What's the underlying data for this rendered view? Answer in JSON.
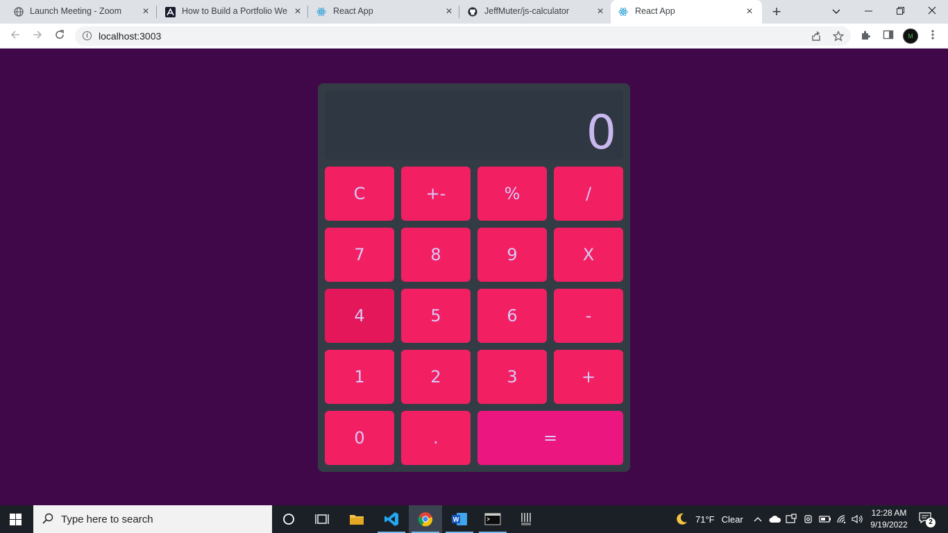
{
  "browser": {
    "tabs": [
      {
        "title": "Launch Meeting - Zoom",
        "icon": "globe-icon",
        "active": false
      },
      {
        "title": "How to Build a Portfolio Web",
        "icon": "site-logo-icon",
        "active": false
      },
      {
        "title": "React App",
        "icon": "react-icon",
        "active": false
      },
      {
        "title": "JeffMuter/js-calculator",
        "icon": "github-icon",
        "active": false
      },
      {
        "title": "React App",
        "icon": "react-icon",
        "active": true
      }
    ],
    "url": "localhost:3003"
  },
  "calculator": {
    "display": "0",
    "keys": {
      "clear": "C",
      "sign": "+-",
      "percent": "%",
      "divide": "/",
      "seven": "7",
      "eight": "8",
      "nine": "9",
      "multiply": "X",
      "four": "4",
      "five": "5",
      "six": "6",
      "subtract": "-",
      "one": "1",
      "two": "2",
      "three": "3",
      "add": "+",
      "zero": "0",
      "decimal": ".",
      "equals": "="
    },
    "colors": {
      "page_background": "#400848",
      "body": "#333c45",
      "display": "#2f3842",
      "display_text": "#c8b8ee",
      "key": "#f21f63",
      "key_pressed": "#e3175a",
      "equals_key": "#ec1680",
      "key_text": "#d9c9f6"
    }
  },
  "taskbar": {
    "search_placeholder": "Type here to search",
    "weather": {
      "temp": "71°F",
      "condition": "Clear"
    },
    "time": "12:28 AM",
    "date": "9/19/2022",
    "notifications": "2"
  }
}
